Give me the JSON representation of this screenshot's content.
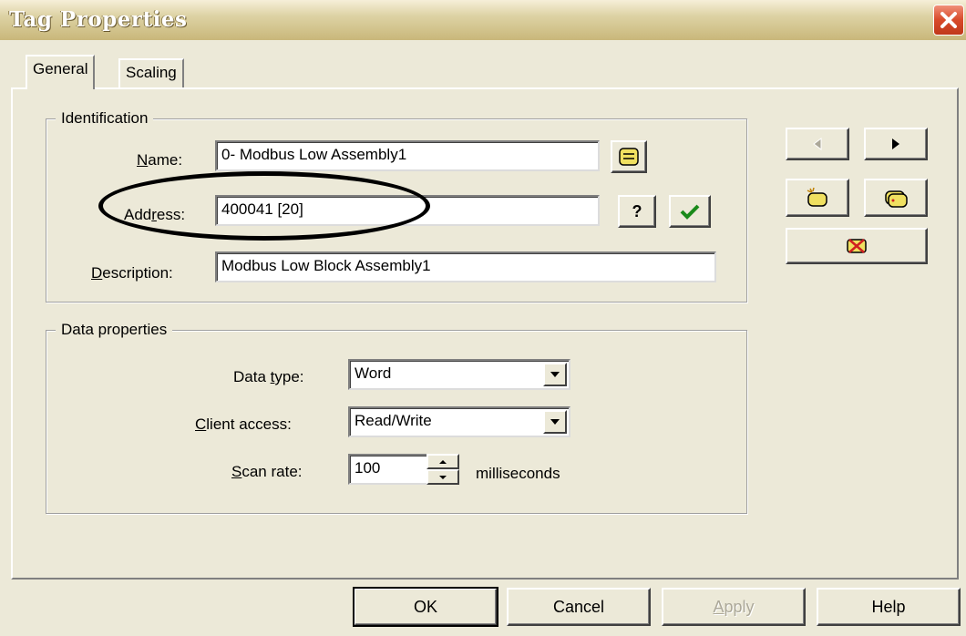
{
  "window": {
    "title": "Tag Properties",
    "close_icon": "close-icon"
  },
  "tabs": [
    {
      "label": "General",
      "active": true
    },
    {
      "label": "Scaling",
      "active": false
    }
  ],
  "identification": {
    "legend": "Identification",
    "name_label_key": "N",
    "name_label_rest": "ame:",
    "name_value": "0- Modbus Low Assembly1",
    "address_label_pre": "Add",
    "address_label_key": "r",
    "address_label_rest": "ess:",
    "address_value": "400041 [20]",
    "description_label_key": "D",
    "description_label_rest": "escription:",
    "description_value": "Modbus Low Block Assembly1",
    "help_button": "?"
  },
  "data_properties": {
    "legend": "Data properties",
    "data_type_label_pre": "Data ",
    "data_type_label_key": "t",
    "data_type_label_rest": "ype:",
    "data_type_value": "Word",
    "client_access_label_key": "C",
    "client_access_label_rest": "lient access:",
    "client_access_value": "Read/Write",
    "scan_rate_label_key": "S",
    "scan_rate_label_rest": "can rate:",
    "scan_rate_value": "100",
    "scan_rate_unit": "milliseconds"
  },
  "buttons": {
    "ok": "OK",
    "cancel": "Cancel",
    "apply_key": "A",
    "apply_rest": "pply",
    "help": "Help"
  },
  "colors": {
    "dialog_bg": "#ece9d8",
    "accept_check": "#1a8a1a",
    "tag_icon": "#f0e060",
    "delete_x": "#d02020"
  }
}
